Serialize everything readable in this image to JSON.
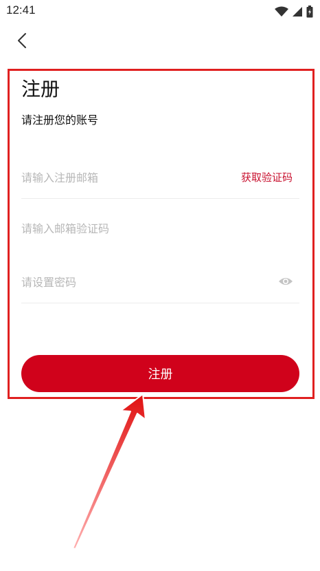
{
  "status_bar": {
    "time": "12:41"
  },
  "header": {
    "back_icon": "chevron-left-icon"
  },
  "form": {
    "title": "注册",
    "subtitle": "请注册您的账号",
    "email_placeholder": "请输入注册邮箱",
    "email_value": "",
    "get_code_label": "获取验证码",
    "code_placeholder": "请输入邮箱验证码",
    "code_value": "",
    "password_placeholder": "请设置密码",
    "password_value": "",
    "password_toggle_icon": "eye-icon",
    "submit_label": "注册"
  },
  "colors": {
    "accent": "#d0021b",
    "link": "#c8102e",
    "annotation": "#e02020"
  }
}
